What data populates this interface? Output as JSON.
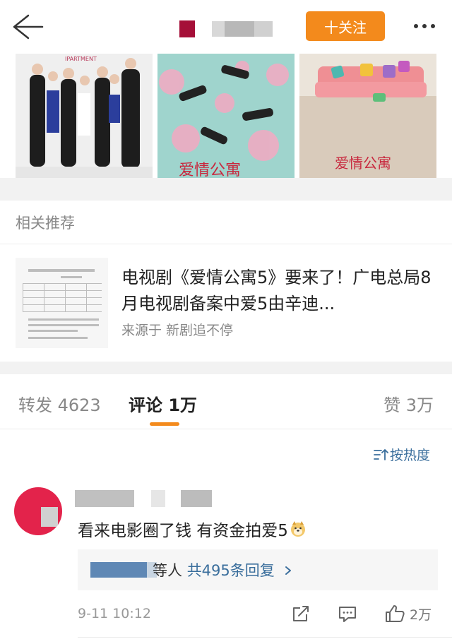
{
  "topbar": {
    "follow_label": "十关注"
  },
  "related": {
    "header": "相关推荐",
    "title": "电视剧《爱情公寓5》要来了！广电总局8月电视剧备案中爱5由辛迪...",
    "source": "来源于 新剧追不停"
  },
  "tabs": {
    "repost": "转发 4623",
    "comment": "评论 1万",
    "like": "赞 3万"
  },
  "sort_label": "按热度",
  "comment": {
    "text": "看来电影圈了钱 有资金拍爱5",
    "replies_prefix": "等人",
    "replies_count": "共495条回复",
    "time": "9-11 10:12",
    "like_count": "2万"
  },
  "colors": {
    "accent": "#f38a1c",
    "link": "#3a6e9c",
    "avatar": "#e3234b"
  },
  "icons": [
    "back-arrow-icon",
    "more-dots-icon",
    "sort-icon",
    "share-icon",
    "comment-icon",
    "like-icon",
    "doge-emoji-icon",
    "chevron-right-icon"
  ]
}
